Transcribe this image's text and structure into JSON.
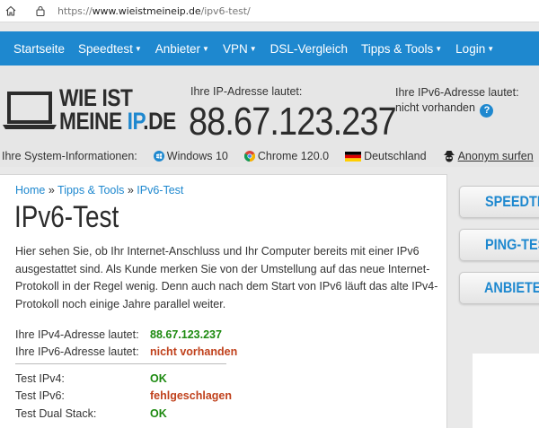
{
  "browser": {
    "url_prefix": "https://",
    "url_main": "www.wieistmeineip.de",
    "url_path": "/ipv6-test/"
  },
  "nav": {
    "items": [
      {
        "label": "Startseite",
        "caret": false
      },
      {
        "label": "Speedtest",
        "caret": true
      },
      {
        "label": "Anbieter",
        "caret": true
      },
      {
        "label": "VPN",
        "caret": true
      },
      {
        "label": "DSL-Vergleich",
        "caret": false
      },
      {
        "label": "Tipps & Tools",
        "caret": true
      },
      {
        "label": "Login",
        "caret": true
      }
    ]
  },
  "header": {
    "brand_line1": "WIE IST",
    "brand_line2a": "MEINE ",
    "brand_line2b": "IP",
    "brand_line2c": ".DE",
    "ip_label": "Ihre IP-Adresse lautet:",
    "ip_value": "88.67.123.237",
    "ipv6_label": "Ihre IPv6-Adresse lautet:",
    "ipv6_value": "nicht vorhanden",
    "help_glyph": "?"
  },
  "sysinfo": {
    "label": "Ihre System-Informationen:",
    "os": "Windows 10",
    "browser": "Chrome 120.0",
    "country": "Deutschland",
    "anon": "Anonym surfen"
  },
  "main": {
    "crumbs": [
      "Home",
      "Tipps & Tools",
      "IPv6-Test"
    ],
    "crumb_sep": "»",
    "title": "IPv6-Test",
    "intro": "Hier sehen Sie, ob Ihr Internet-Anschluss und Ihr Computer bereits mit einer IPv6 ausgestattet sind. Als Kunde merken Sie von der Umstellung auf das neue Internet-Protokoll in der Regel wenig. Denn auch nach dem Start von IPv6 läuft das alte IPv4-Protokoll noch einige Jahre parallel weiter.",
    "address_rows": [
      {
        "label": "Ihre IPv4-Adresse lautet:",
        "value": "88.67.123.237",
        "status": "green"
      },
      {
        "label": "Ihre IPv6-Adresse lautet:",
        "value": "nicht vorhanden",
        "status": "red"
      }
    ],
    "test_rows": [
      {
        "label": "Test IPv4:",
        "value": "OK",
        "status": "green"
      },
      {
        "label": "Test IPv6:",
        "value": "fehlgeschlagen",
        "status": "red"
      },
      {
        "label": "Test Dual Stack:",
        "value": "OK",
        "status": "green"
      }
    ]
  },
  "sidebar": {
    "buttons": [
      "SPEEDTEST",
      "PING-TEST",
      "ANBIETER"
    ]
  },
  "colors": {
    "accent": "#1e88cf",
    "ok": "#1d8a10",
    "fail": "#c0411c"
  }
}
